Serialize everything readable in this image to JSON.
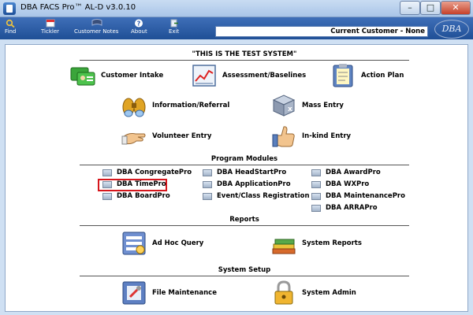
{
  "window": {
    "title": "DBA FACS Pro™ AL-D v3.0.10",
    "close_glyph": "✕",
    "minimize_glyph": "–",
    "maximize_glyph": "□"
  },
  "toolbar": {
    "items": [
      {
        "label": "Find",
        "icon": "search-icon"
      },
      {
        "label": "Tickler",
        "icon": "calendar-icon"
      },
      {
        "label": "Customer Notes",
        "icon": "notes-icon"
      },
      {
        "label": "About",
        "icon": "help-icon"
      },
      {
        "label": "Exit",
        "icon": "exit-icon"
      }
    ],
    "current_customer": "Current Customer - None",
    "logo": "DBA"
  },
  "main": {
    "test_banner": "\"THIS IS THE TEST SYSTEM\"",
    "top_items": [
      {
        "label": "Customer Intake",
        "icon": "customer-intake-icon"
      },
      {
        "label": "Assessment/Baselines",
        "icon": "chart-icon"
      },
      {
        "label": "Action Plan",
        "icon": "clipboard-icon"
      },
      {
        "label": "Information/Referral",
        "icon": "binoculars-icon"
      },
      {
        "label": "Mass Entry",
        "icon": "stack-icon"
      },
      {
        "label": "Volunteer Entry",
        "icon": "hand-icon"
      },
      {
        "label": "In-kind Entry",
        "icon": "thumbs-up-icon"
      }
    ],
    "program_modules": {
      "header": "Program Modules",
      "items": [
        "DBA CongregatePro",
        "DBA HeadStartPro",
        "DBA AwardPro",
        "DBA TimePro",
        "DBA ApplicationPro",
        "DBA WXPro",
        "DBA BoardPro",
        "Event/Class Registration",
        "DBA MaintenancePro",
        "DBA ARRAPro"
      ]
    },
    "reports": {
      "header": "Reports",
      "items": [
        {
          "label": "Ad Hoc Query",
          "icon": "query-icon"
        },
        {
          "label": "System Reports",
          "icon": "books-icon"
        }
      ]
    },
    "system_setup": {
      "header": "System Setup",
      "items": [
        {
          "label": "File Maintenance",
          "icon": "file-maintenance-icon"
        },
        {
          "label": "System Admin",
          "icon": "lock-icon"
        }
      ]
    }
  }
}
